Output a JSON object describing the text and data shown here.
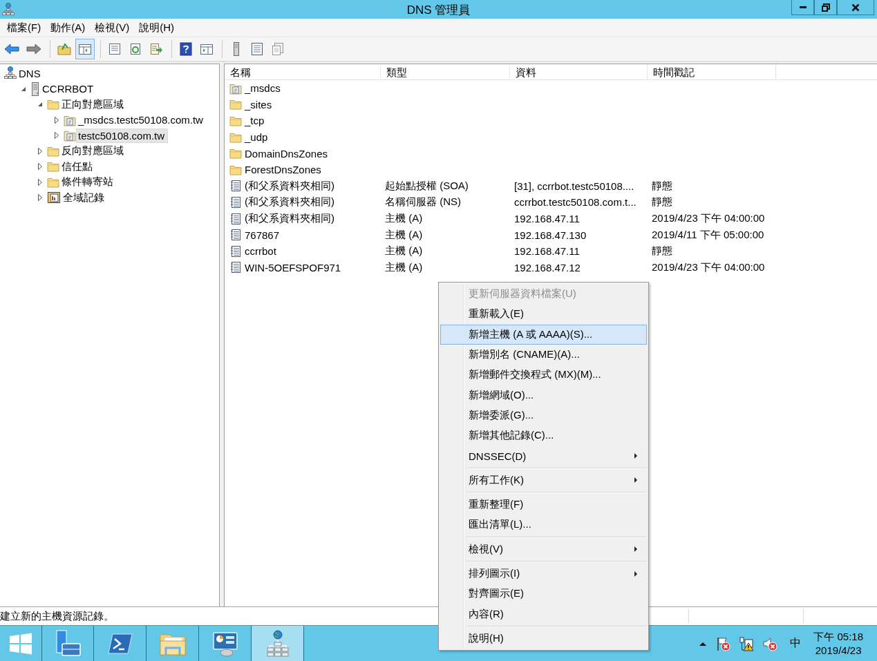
{
  "window": {
    "title": "DNS 管理員"
  },
  "menu_bar": [
    {
      "label": "檔案(F)"
    },
    {
      "label": "動作(A)"
    },
    {
      "label": "檢視(V)"
    },
    {
      "label": "說明(H)"
    }
  ],
  "toolbar": [
    {
      "kind": "back",
      "pressed": false
    },
    {
      "kind": "forward",
      "pressed": false
    },
    {
      "kind": "separator"
    },
    {
      "kind": "up",
      "pressed": false
    },
    {
      "kind": "console-tree",
      "pressed": true
    },
    {
      "kind": "separator"
    },
    {
      "kind": "properties",
      "pressed": false
    },
    {
      "kind": "refresh",
      "pressed": false
    },
    {
      "kind": "export",
      "pressed": false
    },
    {
      "kind": "separator"
    },
    {
      "kind": "help",
      "pressed": false
    },
    {
      "kind": "action-pane",
      "pressed": false
    },
    {
      "kind": "separator"
    },
    {
      "kind": "server",
      "pressed": false
    },
    {
      "kind": "list",
      "pressed": false
    },
    {
      "kind": "copy",
      "pressed": false
    }
  ],
  "tree": [
    {
      "label": "DNS",
      "kind": "dns",
      "selected": false,
      "children": [
        {
          "label": "CCRRBOT",
          "kind": "server",
          "expanded": true,
          "selected": false,
          "children": [
            {
              "label": "正向對應區域",
              "kind": "folder",
              "expanded": true,
              "selected": false,
              "children": [
                {
                  "label": "_msdcs.testc50108.com.tw",
                  "kind": "zone",
                  "expanded": false,
                  "selected": false
                },
                {
                  "label": "testc50108.com.tw",
                  "kind": "zone",
                  "expanded": false,
                  "selected": true
                }
              ]
            },
            {
              "label": "反向對應區域",
              "kind": "folder",
              "expanded": false,
              "selected": false
            },
            {
              "label": "信任點",
              "kind": "folder",
              "expanded": false,
              "selected": false
            },
            {
              "label": "條件轉寄站",
              "kind": "folder",
              "expanded": false,
              "selected": false
            },
            {
              "label": "全域記錄",
              "kind": "log",
              "expanded": false,
              "selected": false
            }
          ]
        }
      ]
    }
  ],
  "list": {
    "columns": [
      "名稱",
      "類型",
      "資料",
      "時間戳記"
    ],
    "rows": [
      {
        "kind": "zone",
        "name": "_msdcs"
      },
      {
        "kind": "folder",
        "name": "_sites"
      },
      {
        "kind": "folder",
        "name": "_tcp"
      },
      {
        "kind": "folder",
        "name": "_udp"
      },
      {
        "kind": "folder",
        "name": "DomainDnsZones"
      },
      {
        "kind": "folder",
        "name": "ForestDnsZones"
      },
      {
        "kind": "record",
        "name": "(和父系資料夾相同)",
        "type": "起始點授權 (SOA)",
        "data": "[31], ccrrbot.testc50108....",
        "timestamp": "靜態"
      },
      {
        "kind": "record",
        "name": "(和父系資料夾相同)",
        "type": "名稱伺服器 (NS)",
        "data": "ccrrbot.testc50108.com.t...",
        "timestamp": "靜態"
      },
      {
        "kind": "record",
        "name": "(和父系資料夾相同)",
        "type": "主機 (A)",
        "data": "192.168.47.11",
        "timestamp": "2019/4/23 下午 04:00:00"
      },
      {
        "kind": "record",
        "name": "767867",
        "type": "主機 (A)",
        "data": "192.168.47.130",
        "timestamp": "2019/4/11 下午 05:00:00"
      },
      {
        "kind": "record",
        "name": "ccrrbot",
        "type": "主機 (A)",
        "data": "192.168.47.11",
        "timestamp": "靜態"
      },
      {
        "kind": "record",
        "name": "WIN-5OEFSPOF971",
        "type": "主機 (A)",
        "data": "192.168.47.12",
        "timestamp": "2019/4/23 下午 04:00:00"
      }
    ]
  },
  "context_menu": {
    "groups": [
      {
        "items": [
          {
            "label": "更新伺服器資料檔案(U)",
            "disabled": true,
            "selected": false,
            "submenu": false
          },
          {
            "label": "重新載入(E)",
            "disabled": false,
            "selected": false,
            "submenu": false
          },
          {
            "label": "新增主機 (A 或 AAAA)(S)...",
            "disabled": false,
            "selected": true,
            "submenu": false
          },
          {
            "label": "新增別名 (CNAME)(A)...",
            "disabled": false,
            "selected": false,
            "submenu": false
          },
          {
            "label": "新增郵件交換程式 (MX)(M)...",
            "disabled": false,
            "selected": false,
            "submenu": false
          },
          {
            "label": "新增網域(O)...",
            "disabled": false,
            "selected": false,
            "submenu": false
          },
          {
            "label": "新增委派(G)...",
            "disabled": false,
            "selected": false,
            "submenu": false
          },
          {
            "label": "新增其他記錄(C)...",
            "disabled": false,
            "selected": false,
            "submenu": false
          },
          {
            "label": "DNSSEC(D)",
            "disabled": false,
            "selected": false,
            "submenu": true
          }
        ]
      },
      {
        "items": [
          {
            "label": "所有工作(K)",
            "disabled": false,
            "selected": false,
            "submenu": true
          }
        ]
      },
      {
        "items": [
          {
            "label": "重新整理(F)",
            "disabled": false,
            "selected": false,
            "submenu": false
          },
          {
            "label": "匯出清單(L)...",
            "disabled": false,
            "selected": false,
            "submenu": false
          }
        ]
      },
      {
        "items": [
          {
            "label": "檢視(V)",
            "disabled": false,
            "selected": false,
            "submenu": true
          }
        ]
      },
      {
        "items": [
          {
            "label": "排列圖示(I)",
            "disabled": false,
            "selected": false,
            "submenu": true
          },
          {
            "label": "對齊圖示(E)",
            "disabled": false,
            "selected": false,
            "submenu": false
          },
          {
            "label": "內容(R)",
            "disabled": false,
            "selected": false,
            "submenu": false
          }
        ]
      },
      {
        "items": [
          {
            "label": "說明(H)",
            "disabled": false,
            "selected": false,
            "submenu": false
          }
        ]
      }
    ]
  },
  "status_bar": {
    "text": "建立新的主機資源記錄。"
  },
  "taskbar": {
    "apps": [
      {
        "kind": "start",
        "selected": false
      },
      {
        "kind": "server-manager",
        "selected": false
      },
      {
        "kind": "powershell",
        "selected": false
      },
      {
        "kind": "explorer",
        "selected": false
      },
      {
        "kind": "control-panel",
        "selected": false
      },
      {
        "kind": "dns",
        "selected": true
      }
    ],
    "tray": {
      "ime": "中",
      "time": "下午 05:18",
      "date": "2019/4/23"
    }
  }
}
